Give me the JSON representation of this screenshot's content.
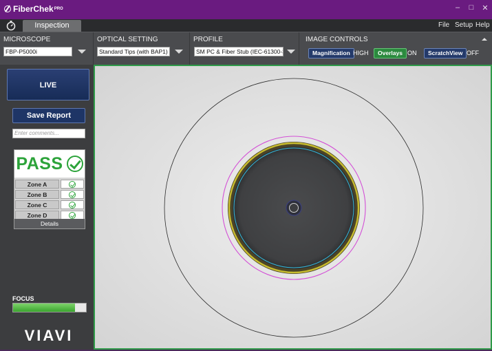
{
  "titlebar": {
    "app_name": "FiberChek",
    "app_superscript": "PRO",
    "minimize": "–",
    "maximize": "□",
    "close": "✕"
  },
  "tabbar": {
    "active_tab": "Inspection",
    "menu": [
      "File",
      "Setup",
      "Help"
    ]
  },
  "settings": {
    "microscope": {
      "title": "MICROSCOPE",
      "value": "FBP-P5000i"
    },
    "optical": {
      "title": "OPTICAL SETTING",
      "value": "Standard Tips (with BAP1)"
    },
    "profile": {
      "title": "PROFILE",
      "value": "SM PC & Fiber Stub (IEC-61300-3"
    },
    "image_controls": {
      "title": "IMAGE CONTROLS",
      "magnification": {
        "label": "Magnification",
        "state": "HIGH"
      },
      "overlays": {
        "label": "Overlays",
        "state": "ON"
      },
      "scratchview": {
        "label": "ScratchView",
        "state": "OFF"
      }
    }
  },
  "left_panel": {
    "live_label": "LIVE",
    "save_report_label": "Save Report",
    "comments_placeholder": "Enter comments...",
    "result": "PASS",
    "zones": [
      {
        "label": "Zone A",
        "status": "pass"
      },
      {
        "label": "Zone B",
        "status": "pass"
      },
      {
        "label": "Zone C",
        "status": "pass"
      },
      {
        "label": "Zone D",
        "status": "pass"
      }
    ],
    "details_label": "Details",
    "focus_label": "FOCUS",
    "focus_level": 0.85,
    "brand_logo": "VIAVI"
  },
  "colors": {
    "titlebar": "#6a1b80",
    "pass_green": "#2ca33a",
    "viewer_border": "#2e9a48",
    "zone_magenta": "#d34fd6",
    "zone_cyan": "#35b8d8",
    "zone_yellow": "#c8bd2f"
  }
}
